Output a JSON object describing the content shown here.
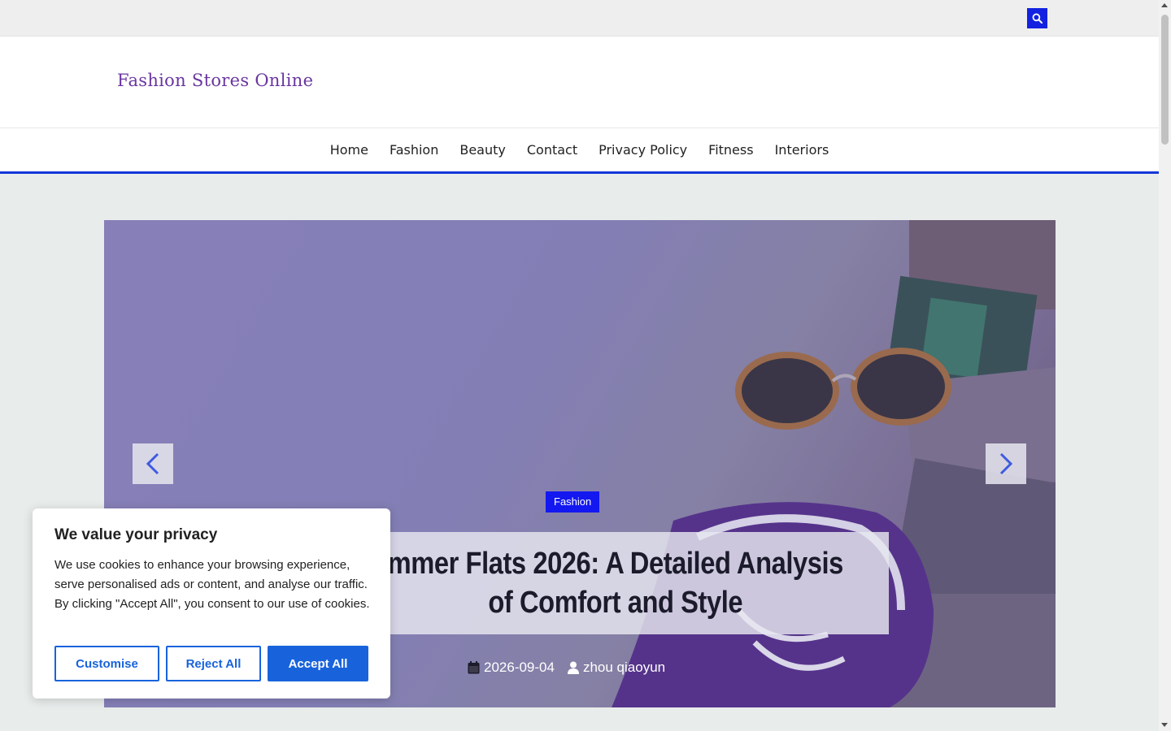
{
  "topbar": {
    "search_icon": "search-icon",
    "accent": "#1222e0"
  },
  "header": {
    "site_title": "Fashion Stores Online"
  },
  "nav": {
    "items": [
      "Home",
      "Fashion",
      "Beauty",
      "Contact",
      "Privacy Policy",
      "Fitness",
      "Interiors"
    ],
    "accent": "#1437d8"
  },
  "hero": {
    "category": "Fashion",
    "title_line1": "mmer Flats 2026: A Detailed Analysis",
    "title_line2": "of Comfort and Style",
    "date": "2026-09-04",
    "author": "zhou qiaoyun",
    "prev_icon": "chevron-left-icon",
    "next_icon": "chevron-right-icon"
  },
  "cookie": {
    "heading": "We value your privacy",
    "description": "We use cookies to enhance your browsing experience, serve personalised ads or content, and analyse our traffic. By clicking \"Accept All\", you consent to our use of cookies.",
    "buttons": {
      "customise": "Customise",
      "reject": "Reject All",
      "accept": "Accept All"
    },
    "accent": "#1863dc"
  }
}
